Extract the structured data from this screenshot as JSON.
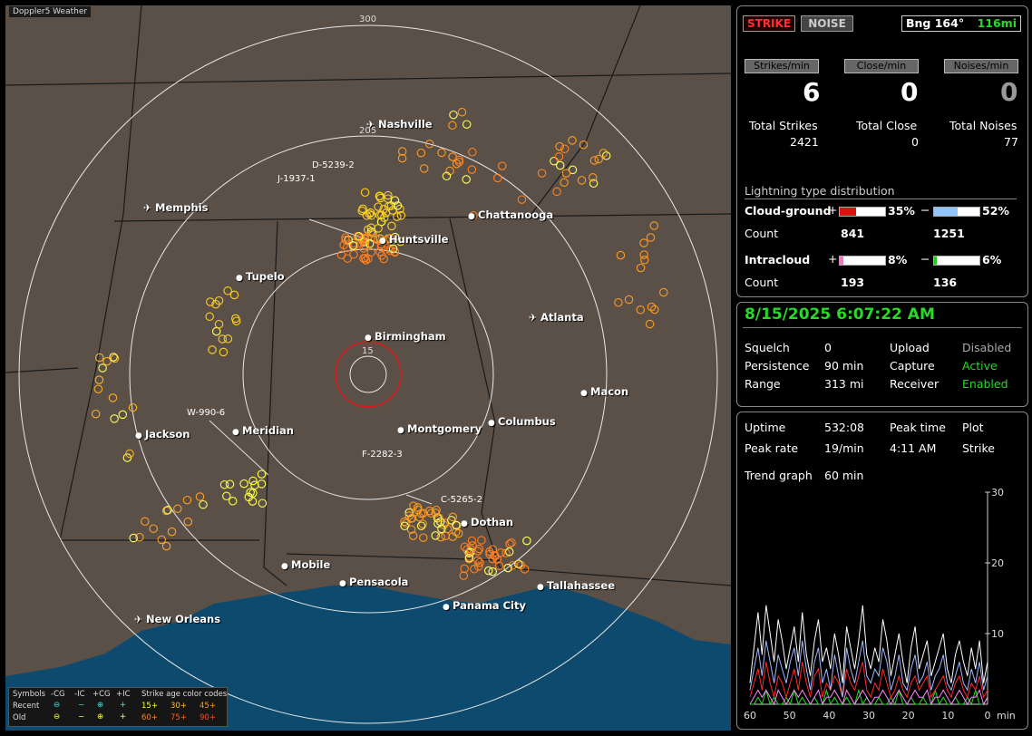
{
  "map": {
    "title": "Doppler5 Weather",
    "range_labels": [
      "300",
      "205",
      "15"
    ],
    "cities": [
      {
        "name": "Nashville",
        "airport": true
      },
      {
        "name": "Memphis",
        "airport": true
      },
      {
        "name": "Chattanooga",
        "airport": false
      },
      {
        "name": "Huntsville",
        "airport": false
      },
      {
        "name": "Tupelo",
        "airport": false
      },
      {
        "name": "Atlanta",
        "airport": true
      },
      {
        "name": "Birmingham",
        "airport": false
      },
      {
        "name": "Macon",
        "airport": false
      },
      {
        "name": "Jackson",
        "airport": false
      },
      {
        "name": "Meridian",
        "airport": false
      },
      {
        "name": "Montgomery",
        "airport": false
      },
      {
        "name": "Columbus",
        "airport": false
      },
      {
        "name": "Dothan",
        "airport": false
      },
      {
        "name": "Mobile",
        "airport": false
      },
      {
        "name": "Pensacola",
        "airport": false
      },
      {
        "name": "Tallahassee",
        "airport": false
      },
      {
        "name": "Panama City",
        "airport": false
      },
      {
        "name": "New Orleans",
        "airport": true
      }
    ],
    "storms": [
      "D-5239-2",
      "J-1937-1",
      "W-990-6",
      "F-2282-3",
      "C-5265-2"
    ],
    "legend": {
      "symbols_label": "Symbols",
      "neg_cg": "-CG",
      "neg_ic": "-IC",
      "pos_cg": "+CG",
      "pos_ic": "+IC",
      "age_label": "Strike age color codes",
      "recent": "Recent",
      "old": "Old",
      "recent_ages": [
        "15+",
        "30+",
        "45+"
      ],
      "old_ages": [
        "60+",
        "75+",
        "90+"
      ]
    }
  },
  "top": {
    "strike_btn": "STRIKE",
    "noise_btn": "NOISE",
    "bearing": "Bng 164°",
    "distance": "116mi",
    "strikes_min_label": "Strikes/min",
    "close_min_label": "Close/min",
    "noises_min_label": "Noises/min",
    "strikes_min": "6",
    "close_min": "0",
    "noises_min": "0",
    "total_strikes_label": "Total Strikes",
    "total_close_label": "Total Close",
    "total_noises_label": "Total Noises",
    "total_strikes": "2421",
    "total_close": "0",
    "total_noises": "77",
    "dist_title": "Lightning type distribution",
    "cg_label": "Cloud-ground",
    "ic_label": "Intracloud",
    "count_label": "Count",
    "plus": "+",
    "minus": "−",
    "cg_pos_pct_text": "35%",
    "cg_neg_pct_text": "52%",
    "ic_pos_pct_text": "8%",
    "ic_neg_pct_text": "6%",
    "cg_pos_pct": 35,
    "cg_neg_pct": 52,
    "ic_pos_pct": 8,
    "ic_neg_pct": 6,
    "cg_pos_count": "841",
    "cg_neg_count": "1251",
    "ic_pos_count": "193",
    "ic_neg_count": "136"
  },
  "mid": {
    "datetime": "8/15/2025 6:07:22 AM",
    "squelch_label": "Squelch",
    "squelch": "0",
    "persistence_label": "Persistence",
    "persistence": "90 min",
    "range_label": "Range",
    "range": "313 mi",
    "upload_label": "Upload",
    "upload": "Disabled",
    "capture_label": "Capture",
    "capture": "Active",
    "receiver_label": "Receiver",
    "receiver": "Enabled"
  },
  "bottom": {
    "uptime_label": "Uptime",
    "uptime": "532:08",
    "peak_time_label": "Peak time",
    "plot_label": "Plot",
    "peak_rate_label": "Peak rate",
    "peak_rate": "19/min",
    "peak_time": "4:11 AM",
    "plot": "Strike",
    "trend_label": "Trend graph",
    "trend_value": "60 min"
  },
  "chart_data": {
    "type": "line",
    "xlabel": "min",
    "x_ticks": [
      "60",
      "50",
      "40",
      "30",
      "20",
      "10",
      "0"
    ],
    "y_ticks": [
      "30",
      "20",
      "10"
    ],
    "ylim": [
      0,
      30
    ],
    "xlim": [
      60,
      0
    ],
    "series": [
      {
        "color": "#ffffff",
        "values": [
          3,
          8,
          13,
          7,
          14,
          10,
          6,
          12,
          9,
          5,
          8,
          11,
          6,
          13,
          7,
          4,
          9,
          12,
          6,
          8,
          5,
          10,
          7,
          3,
          11,
          8,
          5,
          9,
          14,
          7,
          5,
          8,
          6,
          12,
          9,
          4,
          7,
          10,
          6,
          3,
          8,
          11,
          5,
          7,
          9,
          4,
          6,
          8,
          10,
          5,
          3,
          7,
          9,
          6,
          4,
          8,
          5,
          9,
          3,
          6
        ]
      },
      {
        "color": "#a0b8ff",
        "values": [
          2,
          5,
          8,
          4,
          9,
          6,
          3,
          7,
          5,
          3,
          6,
          8,
          4,
          9,
          5,
          2,
          6,
          8,
          3,
          5,
          2,
          7,
          4,
          1,
          8,
          5,
          3,
          6,
          9,
          4,
          3,
          5,
          4,
          8,
          6,
          2,
          4,
          7,
          3,
          2,
          5,
          7,
          3,
          4,
          6,
          2,
          4,
          5,
          7,
          3,
          2,
          4,
          6,
          3,
          2,
          5,
          3,
          6,
          2,
          4
        ]
      },
      {
        "color": "#ff2a2a",
        "values": [
          1,
          3,
          5,
          2,
          6,
          3,
          1,
          4,
          3,
          1,
          3,
          5,
          2,
          6,
          3,
          1,
          4,
          5,
          1,
          3,
          2,
          4,
          3,
          1,
          5,
          3,
          2,
          4,
          6,
          2,
          1,
          3,
          2,
          5,
          3,
          1,
          2,
          4,
          2,
          1,
          3,
          4,
          2,
          3,
          4,
          1,
          2,
          3,
          4,
          2,
          1,
          3,
          4,
          2,
          1,
          3,
          2,
          4,
          1,
          2
        ]
      },
      {
        "color": "#ff88ff",
        "values": [
          0,
          1,
          2,
          1,
          2,
          1,
          0,
          2,
          1,
          0,
          1,
          2,
          1,
          2,
          1,
          0,
          1,
          2,
          0,
          1,
          1,
          2,
          1,
          0,
          2,
          1,
          0,
          1,
          2,
          1,
          0,
          1,
          1,
          2,
          1,
          0,
          1,
          2,
          1,
          0,
          1,
          2,
          1,
          1,
          2,
          0,
          1,
          1,
          2,
          1,
          0,
          1,
          2,
          1,
          0,
          1,
          1,
          2,
          0,
          1
        ]
      },
      {
        "color": "#22dd22",
        "values": [
          0,
          0,
          1,
          0,
          2,
          0,
          1,
          0,
          0,
          1,
          0,
          2,
          0,
          1,
          0,
          0,
          1,
          0,
          0,
          2,
          0,
          1,
          0,
          0,
          1,
          0,
          0,
          2,
          0,
          1,
          0,
          0,
          1,
          0,
          0,
          1,
          0,
          2,
          0,
          0,
          1,
          0,
          0,
          1,
          0,
          0,
          2,
          0,
          1,
          0,
          0,
          1,
          0,
          0,
          1,
          0,
          2,
          0,
          0,
          1
        ]
      }
    ]
  }
}
